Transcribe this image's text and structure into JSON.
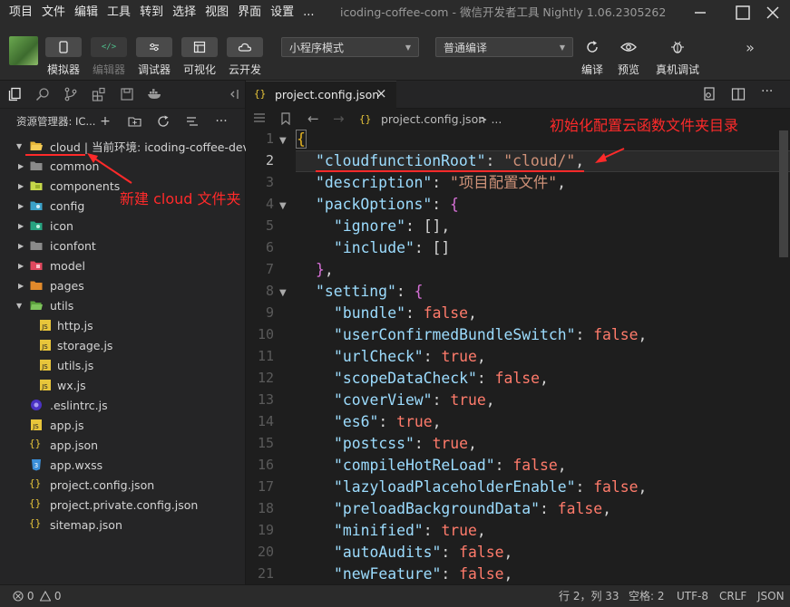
{
  "menubar": {
    "items": [
      "项目",
      "文件",
      "编辑",
      "工具",
      "转到",
      "选择",
      "视图",
      "界面",
      "设置",
      "..."
    ],
    "window_title": "icoding-coffee-com - 微信开发者工具 Nightly 1.06.2305262"
  },
  "toolbar": {
    "simulator": "模拟器",
    "editor": "编辑器",
    "debugger": "调试器",
    "visual": "可视化",
    "cloud_dev": "云开发",
    "mode_select": "小程序模式",
    "compile_select": "普通编译",
    "compile": "编译",
    "preview": "预览",
    "device_debug": "真机调试"
  },
  "explorer": {
    "title": "资源管理器: IC...",
    "root_folder": "cloud | 当前环境: icoding-coffee-dev",
    "items": [
      {
        "name": "common",
        "kind": "folder"
      },
      {
        "name": "components",
        "kind": "folder"
      },
      {
        "name": "config",
        "kind": "folder"
      },
      {
        "name": "icon",
        "kind": "folder"
      },
      {
        "name": "iconfont",
        "kind": "folder"
      },
      {
        "name": "model",
        "kind": "folder"
      },
      {
        "name": "pages",
        "kind": "folder"
      },
      {
        "name": "utils",
        "kind": "folder-open"
      },
      {
        "name": "http.js",
        "kind": "js"
      },
      {
        "name": "storage.js",
        "kind": "js"
      },
      {
        "name": "utils.js",
        "kind": "js"
      },
      {
        "name": "wx.js",
        "kind": "js"
      },
      {
        "name": ".eslintrc.js",
        "kind": "eslint"
      },
      {
        "name": "app.js",
        "kind": "js"
      },
      {
        "name": "app.json",
        "kind": "json"
      },
      {
        "name": "app.wxss",
        "kind": "css"
      },
      {
        "name": "project.config.json",
        "kind": "json"
      },
      {
        "name": "project.private.config.json",
        "kind": "json"
      },
      {
        "name": "sitemap.json",
        "kind": "json"
      }
    ]
  },
  "editor": {
    "tab_label": "project.config.json",
    "breadcrumb": "project.config.json",
    "breadcrumb_more": "> ...",
    "line_numbers": [
      "1",
      "2",
      "3",
      "4",
      "5",
      "6",
      "7",
      "8",
      "9",
      "10",
      "11",
      "12",
      "13",
      "14",
      "15",
      "16",
      "17",
      "18",
      "19",
      "20",
      "21"
    ],
    "active_line": 2
  },
  "code": {
    "l2_key": "\"cloudfunctionRoot\"",
    "l2_val": "\"cloud/\"",
    "l3_key": "\"description\"",
    "l3_val": "\"项目配置文件\"",
    "l4_key": "\"packOptions\"",
    "l5_key": "\"ignore\"",
    "l6_key": "\"include\"",
    "l8_key": "\"setting\"",
    "settings": [
      {
        "key": "\"bundle\"",
        "value": "false"
      },
      {
        "key": "\"userConfirmedBundleSwitch\"",
        "value": "false"
      },
      {
        "key": "\"urlCheck\"",
        "value": "true"
      },
      {
        "key": "\"scopeDataCheck\"",
        "value": "false"
      },
      {
        "key": "\"coverView\"",
        "value": "true"
      },
      {
        "key": "\"es6\"",
        "value": "true"
      },
      {
        "key": "\"postcss\"",
        "value": "true"
      },
      {
        "key": "\"compileHotReLoad\"",
        "value": "false"
      },
      {
        "key": "\"lazyloadPlaceholderEnable\"",
        "value": "false"
      },
      {
        "key": "\"preloadBackgroundData\"",
        "value": "false"
      },
      {
        "key": "\"minified\"",
        "value": "true"
      },
      {
        "key": "\"autoAudits\"",
        "value": "false"
      },
      {
        "key": "\"newFeature\"",
        "value": "false"
      }
    ]
  },
  "annotations": {
    "top": "初始化配置云函数文件夹目录",
    "left": "新建 cloud 文件夹"
  },
  "statusbar": {
    "errors": "0",
    "warnings": "0",
    "position": "行 2，列 33",
    "spaces": "空格: 2",
    "encoding": "UTF-8",
    "eol": "CRLF",
    "language": "JSON"
  }
}
